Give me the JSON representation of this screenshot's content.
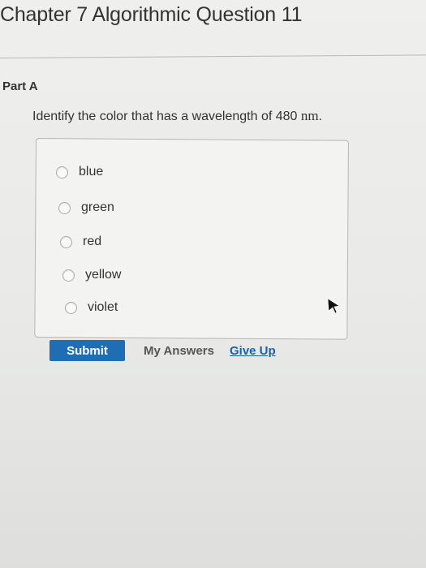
{
  "header": {
    "title": "Chapter 7 Algorithmic Question 11"
  },
  "part": {
    "label": "Part A"
  },
  "question": {
    "text": "Identify the color that has a wavelength of 480 ",
    "unit": "nm",
    "end": "."
  },
  "options": [
    {
      "label": "blue"
    },
    {
      "label": "green"
    },
    {
      "label": "red"
    },
    {
      "label": "yellow"
    },
    {
      "label": "violet"
    }
  ],
  "actions": {
    "submit_label": "Submit",
    "my_answers_label": "My Answers",
    "give_up_label": "Give Up"
  },
  "colors": {
    "accent": "#1f6db3",
    "link": "#1f5ea8"
  },
  "icons": {
    "pointer": "mouse-pointer-icon"
  }
}
